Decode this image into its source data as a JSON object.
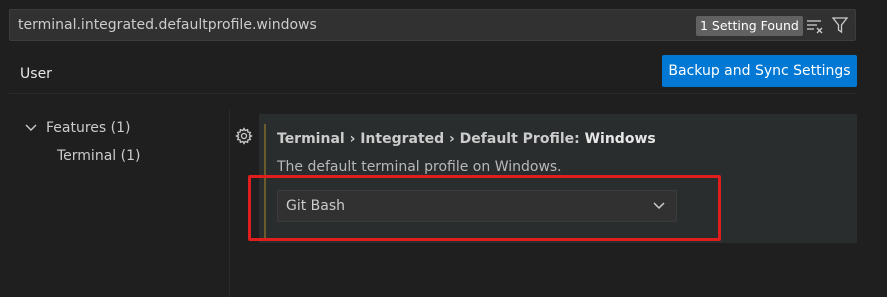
{
  "search": {
    "value": "terminal.integrated.defaultprofile.windows",
    "result_badge": "1 Setting Found"
  },
  "tabs": [
    {
      "label": "User",
      "active": true
    }
  ],
  "header": {
    "sync_button_label": "Backup and Sync Settings"
  },
  "toc": {
    "features": {
      "label": "Features (1)",
      "expanded": true
    },
    "terminal": {
      "label": "Terminal (1)"
    }
  },
  "setting": {
    "category": "Terminal › Integrated › Default Profile: ",
    "name": "Windows",
    "description": "The default terminal profile on Windows.",
    "selected_value": "Git Bash"
  },
  "icons": [
    "clear-filter-icon",
    "filter-icon",
    "chevron-down-icon",
    "gear-icon"
  ],
  "colors": {
    "accent_button": "#0078d4",
    "highlight": "#e01e1e",
    "background": "#1f1f1f"
  }
}
